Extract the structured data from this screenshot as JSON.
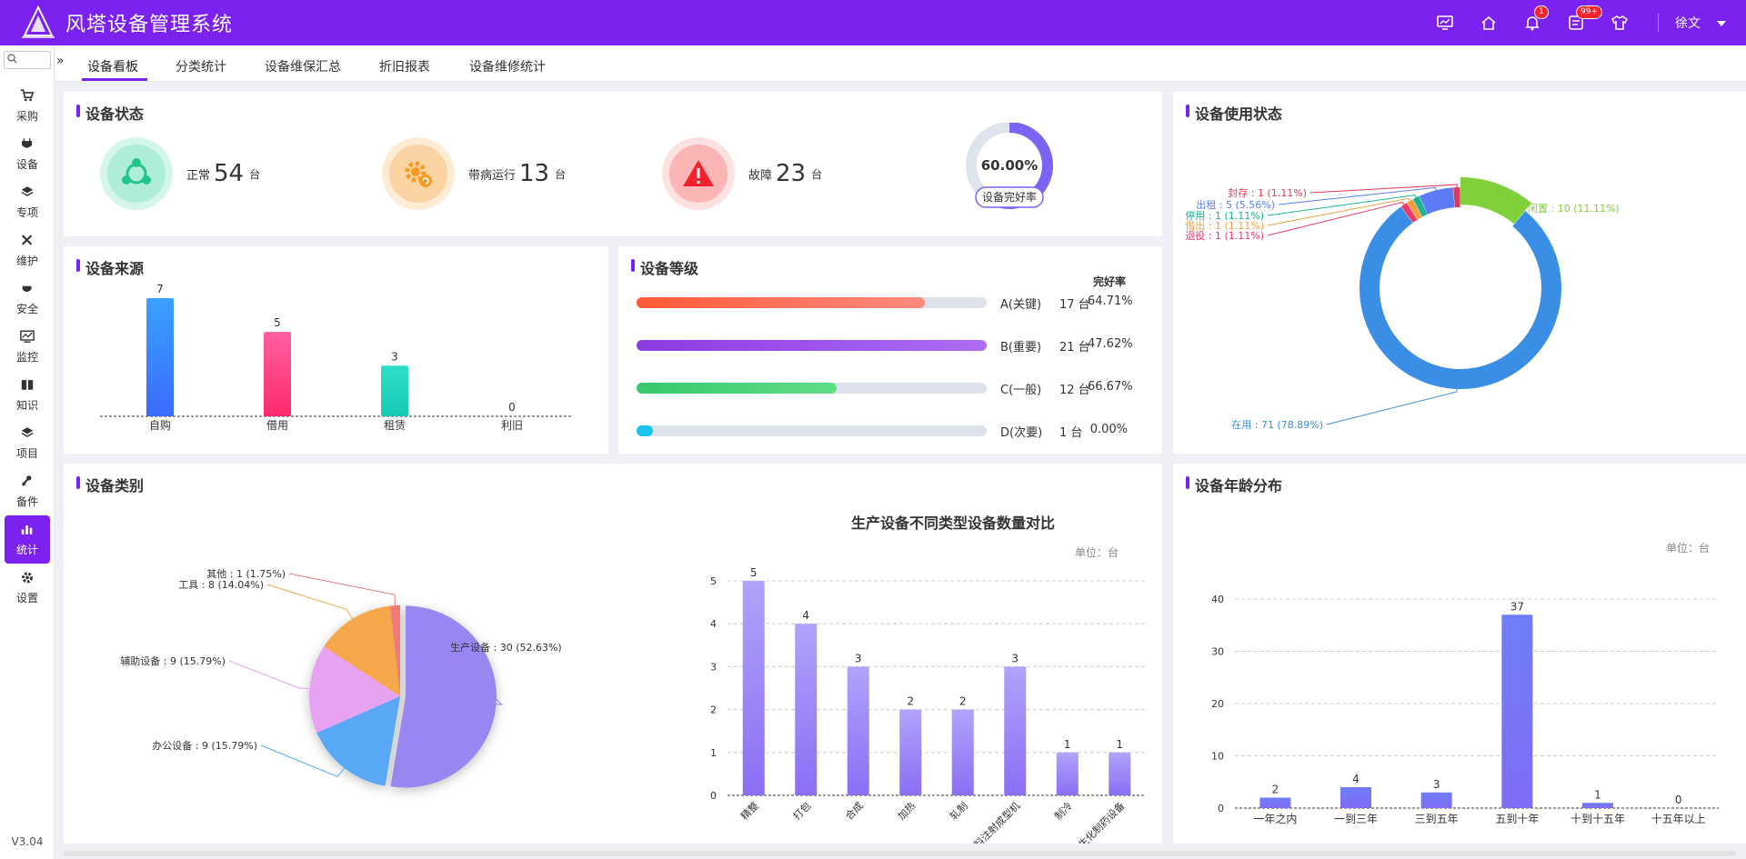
{
  "app": {
    "title": "风塔设备管理系统",
    "logo_icon": "wind-tower-logo",
    "version": "V3.04",
    "accent": "#7b22f0"
  },
  "topbar": {
    "icons": [
      {
        "name": "monitor-icon",
        "badge": ""
      },
      {
        "name": "home-icon",
        "badge": ""
      },
      {
        "name": "bell-icon",
        "badge": "1"
      },
      {
        "name": "inbox-icon",
        "badge": "99+"
      },
      {
        "name": "shirt-icon",
        "badge": ""
      }
    ],
    "user": "徐文"
  },
  "sidebar": {
    "search_placeholder": "",
    "items": [
      {
        "label": "采购",
        "icon": "cart-icon"
      },
      {
        "label": "设备",
        "icon": "device-icon"
      },
      {
        "label": "专项",
        "icon": "layers-icon"
      },
      {
        "label": "维护",
        "icon": "tools-icon"
      },
      {
        "label": "安全",
        "icon": "shield-icon"
      },
      {
        "label": "监控",
        "icon": "monitor-chart-icon"
      },
      {
        "label": "知识",
        "icon": "book-icon"
      },
      {
        "label": "项目",
        "icon": "stack-icon"
      },
      {
        "label": "备件",
        "icon": "parts-icon"
      },
      {
        "label": "统计",
        "icon": "bar-chart-icon",
        "active": true
      },
      {
        "label": "设置",
        "icon": "gear-icon"
      }
    ]
  },
  "tabs": [
    "设备看板",
    "分类统计",
    "设备维保汇总",
    "折旧报表",
    "设备维修统计"
  ],
  "status_panel": {
    "title": "设备状态",
    "items": [
      {
        "label": "正常",
        "value": "54",
        "unit": "台",
        "color": "#2ecc9a"
      },
      {
        "label": "带病运行",
        "value": "13",
        "unit": "台",
        "color": "#f59a23"
      },
      {
        "label": "故障",
        "value": "23",
        "unit": "台",
        "color": "#f5222d"
      }
    ],
    "rate": {
      "value": "60.00%",
      "fraction": 0.6,
      "label": "设备完好率"
    }
  },
  "source_panel": {
    "title": "设备来源",
    "chart_data": {
      "type": "bar",
      "categories": [
        "自购",
        "借用",
        "租赁",
        "利旧"
      ],
      "values": [
        7,
        5,
        3,
        0
      ],
      "colors": [
        [
          "#3aa0ff",
          "#3a6cff"
        ],
        [
          "#ff5fa0",
          "#ff2a6e"
        ],
        [
          "#2ee0c8",
          "#16c9b2"
        ],
        [
          "#999",
          "#999"
        ]
      ]
    }
  },
  "level_panel": {
    "title": "设备等级",
    "rate_header": "完好率",
    "items": [
      {
        "name": "A(关键)",
        "count": "17 台",
        "rate": "64.71%",
        "fraction": 0.8235,
        "from": "#ff5a36",
        "to": "#ff8a80"
      },
      {
        "name": "B(重要)",
        "count": "21 台",
        "rate": "47.62%",
        "fraction": 1.0,
        "from": "#8a3be0",
        "to": "#b06cf5"
      },
      {
        "name": "C(一般)",
        "count": "12 台",
        "rate": "66.67%",
        "fraction": 0.5714,
        "from": "#38c76a",
        "to": "#5ede85"
      },
      {
        "name": "D(次要)",
        "count": "1 台",
        "rate": "0.00%",
        "fraction": 0.0476,
        "from": "#19c4f0",
        "to": "#19c4f0"
      }
    ]
  },
  "usage_panel": {
    "title": "设备使用状态",
    "chart_data": {
      "type": "pie",
      "slices": [
        {
          "label": "在用 : 71 (78.89%)",
          "value": 71,
          "color": "#3a8ee6"
        },
        {
          "label": "闲置 : 10 (11.11%)",
          "value": 10,
          "color": "#7fd03a"
        },
        {
          "label": "退役 : 1 (1.11%)",
          "value": 1,
          "color": "#ea3a6a"
        },
        {
          "label": "借出 : 1 (1.11%)",
          "value": 1,
          "color": "#f0a040"
        },
        {
          "label": "停用 : 1 (1.11%)",
          "value": 1,
          "color": "#1ab394"
        },
        {
          "label": "出租 : 5 (5.56%)",
          "value": 5,
          "color": "#5b7cf5"
        },
        {
          "label": "封存 : 1 (1.11%)",
          "value": 1,
          "color": "#e0385a"
        }
      ]
    }
  },
  "category_panel": {
    "title": "设备类别",
    "pie": {
      "type": "pie",
      "slices": [
        {
          "label": "生产设备 : 30 (52.63%)",
          "value": 30,
          "color": "#9a86f0"
        },
        {
          "label": "办公设备 : 9 (15.79%)",
          "value": 9,
          "color": "#58a8f5"
        },
        {
          "label": "辅助设备 : 9 (15.79%)",
          "value": 9,
          "color": "#e7a2f2"
        },
        {
          "label": "工具 : 8 (14.04%)",
          "value": 8,
          "color": "#f5a84a"
        },
        {
          "label": "其他 : 1 (1.75%)",
          "value": 1,
          "color": "#f07a7a"
        }
      ]
    },
    "bar": {
      "type": "bar",
      "title": "生产设备不同类型设备数量对比",
      "unit": "单位：台",
      "categories": [
        "精整",
        "打包",
        "合成",
        "加热",
        "轧制",
        "塑料注射成型机",
        "制冷",
        "生化制药设备"
      ],
      "values": [
        5,
        4,
        3,
        2,
        2,
        3,
        1,
        1
      ],
      "yticks": [
        0,
        1,
        2,
        3,
        4,
        5
      ]
    }
  },
  "age_panel": {
    "title": "设备年龄分布",
    "unit": "单位：台",
    "chart_data": {
      "type": "bar",
      "categories": [
        "一年之内",
        "一到三年",
        "三到五年",
        "五到十年",
        "十到十五年",
        "十五年以上"
      ],
      "values": [
        2,
        4,
        3,
        37,
        1,
        0
      ],
      "yticks": [
        0,
        10,
        20,
        30,
        40
      ]
    }
  }
}
